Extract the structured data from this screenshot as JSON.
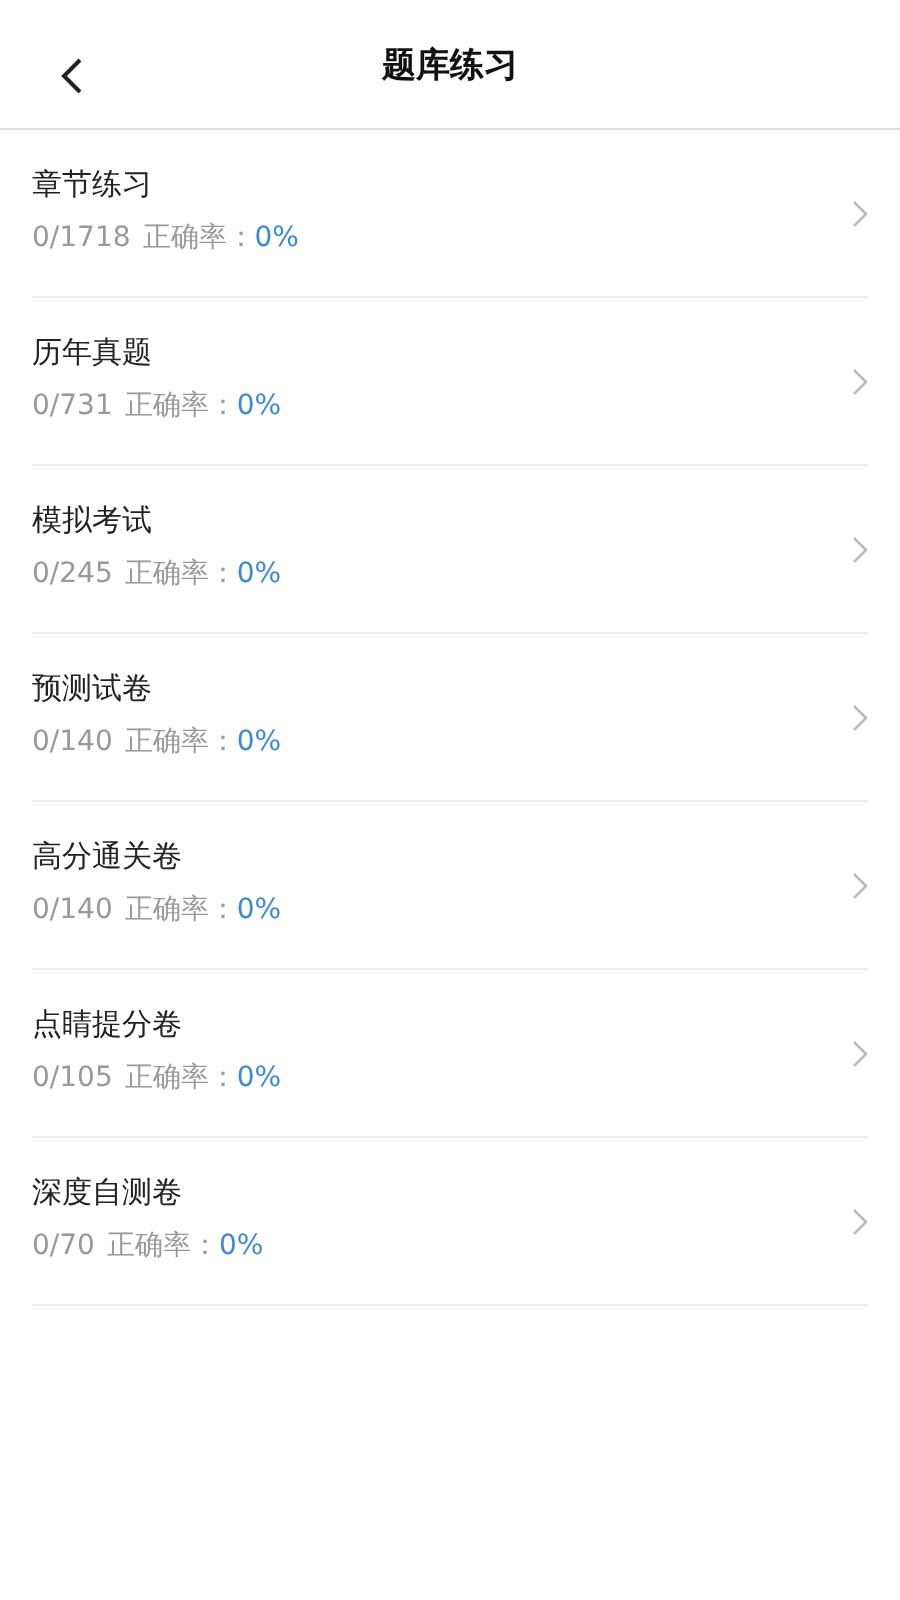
{
  "header": {
    "title": "题库练习"
  },
  "items": [
    {
      "title": "章节练习",
      "count": "0/1718",
      "accuracy_label": "正确率：",
      "accuracy": "0%"
    },
    {
      "title": "历年真题",
      "count": "0/731",
      "accuracy_label": "正确率：",
      "accuracy": "0%"
    },
    {
      "title": "模拟考试",
      "count": "0/245",
      "accuracy_label": "正确率：",
      "accuracy": "0%"
    },
    {
      "title": "预测试卷",
      "count": "0/140",
      "accuracy_label": "正确率：",
      "accuracy": "0%"
    },
    {
      "title": "高分通关卷",
      "count": "0/140",
      "accuracy_label": "正确率：",
      "accuracy": "0%"
    },
    {
      "title": "点睛提分卷",
      "count": "0/105",
      "accuracy_label": "正确率：",
      "accuracy": "0%"
    },
    {
      "title": "深度自测卷",
      "count": "0/70",
      "accuracy_label": "正确率：",
      "accuracy": "0%"
    }
  ]
}
